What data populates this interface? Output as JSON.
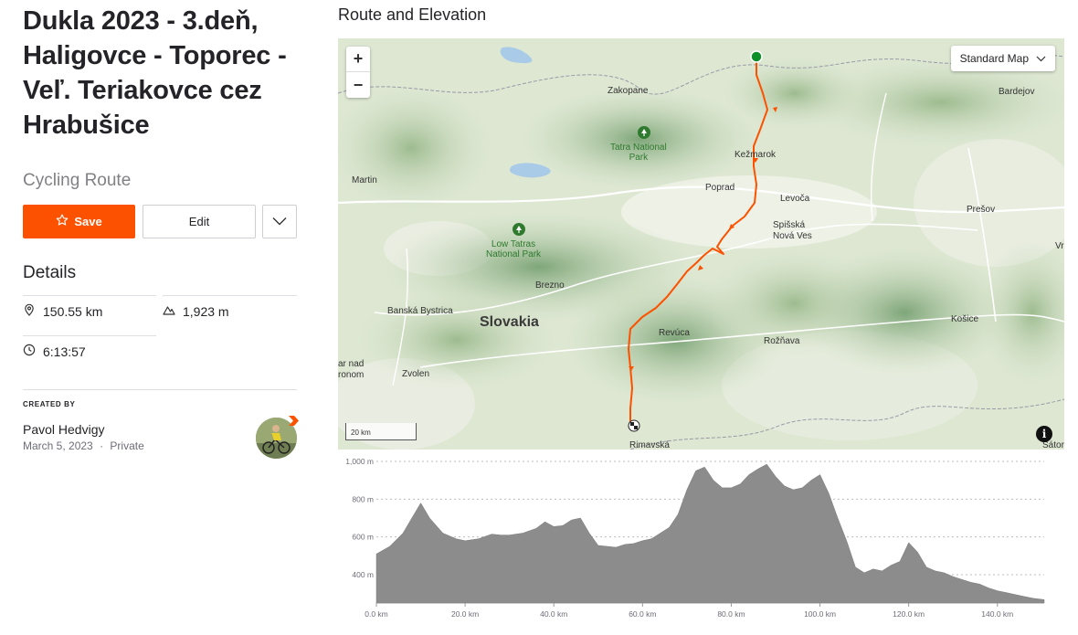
{
  "route": {
    "title": "Dukla 2023 - 3.deň, Haligovce - Toporec - Veľ. Teriakovce cez Hrabušice",
    "type": "Cycling Route"
  },
  "actions": {
    "save_label": "Save",
    "edit_label": "Edit",
    "more_icon": "chevron-down-icon"
  },
  "details": {
    "heading": "Details",
    "distance": "150.55 km",
    "elevation": "1,923 m",
    "duration": "6:13:57"
  },
  "creator": {
    "label": "CREATED BY",
    "name": "Pavol Hedvigy",
    "date": "March 5, 2023",
    "separator": "·",
    "visibility": "Private"
  },
  "map_section": {
    "heading": "Route and Elevation",
    "zoom_in": "+",
    "zoom_out": "−",
    "map_type": "Standard Map",
    "scale": "20 km",
    "info": "i",
    "places": {
      "zakopane": "Zakopane",
      "bardejov": "Bardejov",
      "tatra_park_1": "Tatra National",
      "tatra_park_2": "Park",
      "kezmarok": "Kežmarok",
      "martin": "Martin",
      "poprad": "Poprad",
      "levoca": "Levoča",
      "presov": "Prešov",
      "spisska_1": "Spišská",
      "spisska_2": "Nová Ves",
      "vr": "Vr",
      "low_tatras_1": "Low Tatras",
      "low_tatras_2": "National Park",
      "brezno": "Brezno",
      "banska": "Banská Bystrica",
      "slovakia": "Slovakia",
      "kosice": "Košice",
      "revuca": "Revúca",
      "roznava": "Rožňava",
      "ar_nad": "ar nad",
      "ronom": "ronom",
      "zvolen": "Zvolen",
      "rimavska": "Rimavská",
      "sator": "Sátor"
    },
    "colors": {
      "route": "#fc5200",
      "start": "#0d8f2a",
      "finish": "#222222",
      "accent": "#fc5200",
      "profile": "#8c8c8c"
    }
  },
  "elevation_chart": {
    "y_ticks": [
      "1,000 m",
      "800 m",
      "600 m",
      "400 m"
    ],
    "x_ticks": [
      "0.0 km",
      "20.0 km",
      "40.0 km",
      "60.0 km",
      "80.0 km",
      "100.0 km",
      "120.0 km",
      "140.0 km"
    ]
  },
  "chart_data": {
    "type": "area",
    "xlabel": "",
    "ylabel": "",
    "xlim": [
      0,
      150.55
    ],
    "ylim": [
      250,
      1000
    ],
    "x": [
      0,
      3,
      6,
      8,
      10,
      12,
      15,
      18,
      20,
      23,
      26,
      28,
      30,
      33,
      36,
      38,
      40,
      42,
      44,
      46,
      48,
      50,
      52,
      54,
      56,
      58,
      60,
      62,
      64,
      66,
      68,
      70,
      72,
      74,
      76,
      78,
      80,
      82,
      84,
      86,
      88,
      90,
      92,
      94,
      96,
      98,
      100,
      102,
      104,
      106,
      108,
      110,
      112,
      114,
      116,
      118,
      120,
      122,
      124,
      126,
      128,
      130,
      132,
      134,
      136,
      138,
      140,
      142,
      144,
      146,
      148,
      150.55
    ],
    "y": [
      510,
      550,
      620,
      700,
      780,
      700,
      620,
      590,
      580,
      590,
      615,
      610,
      610,
      620,
      645,
      680,
      655,
      660,
      690,
      700,
      620,
      555,
      550,
      545,
      560,
      565,
      580,
      590,
      620,
      650,
      720,
      850,
      950,
      970,
      900,
      860,
      860,
      880,
      930,
      960,
      985,
      920,
      870,
      850,
      860,
      900,
      930,
      830,
      700,
      580,
      440,
      410,
      430,
      420,
      450,
      470,
      570,
      520,
      440,
      420,
      410,
      390,
      375,
      360,
      350,
      330,
      315,
      305,
      295,
      285,
      275,
      268
    ]
  }
}
